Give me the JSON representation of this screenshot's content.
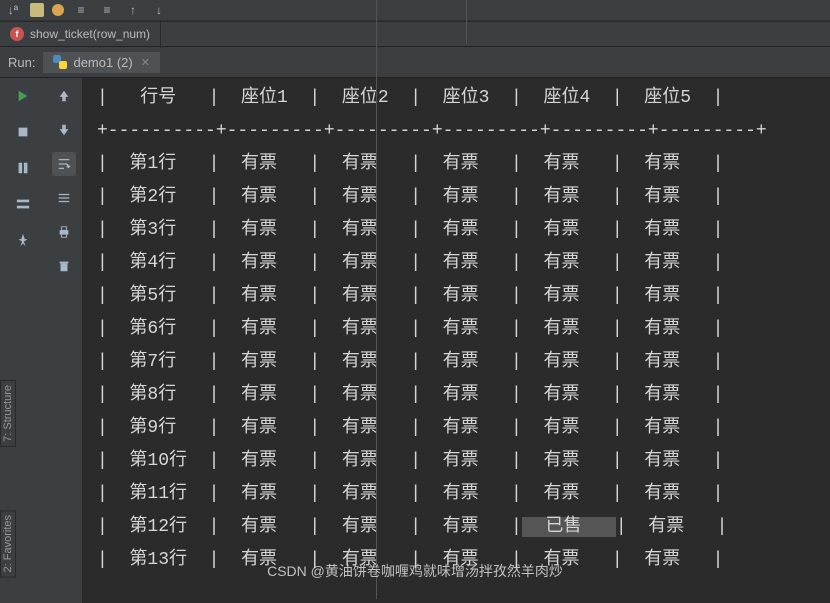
{
  "topTabs": {
    "functionTab": "show_ticket(row_num)"
  },
  "run": {
    "label": "Run:",
    "tabName": "demo1 (2)"
  },
  "table": {
    "headers": [
      "行号",
      "座位1",
      "座位2",
      "座位3",
      "座位4",
      "座位5"
    ],
    "rows": [
      {
        "label": "第1行",
        "cells": [
          "有票",
          "有票",
          "有票",
          "有票",
          "有票"
        ]
      },
      {
        "label": "第2行",
        "cells": [
          "有票",
          "有票",
          "有票",
          "有票",
          "有票"
        ]
      },
      {
        "label": "第3行",
        "cells": [
          "有票",
          "有票",
          "有票",
          "有票",
          "有票"
        ]
      },
      {
        "label": "第4行",
        "cells": [
          "有票",
          "有票",
          "有票",
          "有票",
          "有票"
        ]
      },
      {
        "label": "第5行",
        "cells": [
          "有票",
          "有票",
          "有票",
          "有票",
          "有票"
        ]
      },
      {
        "label": "第6行",
        "cells": [
          "有票",
          "有票",
          "有票",
          "有票",
          "有票"
        ]
      },
      {
        "label": "第7行",
        "cells": [
          "有票",
          "有票",
          "有票",
          "有票",
          "有票"
        ]
      },
      {
        "label": "第8行",
        "cells": [
          "有票",
          "有票",
          "有票",
          "有票",
          "有票"
        ]
      },
      {
        "label": "第9行",
        "cells": [
          "有票",
          "有票",
          "有票",
          "有票",
          "有票"
        ]
      },
      {
        "label": "第10行",
        "cells": [
          "有票",
          "有票",
          "有票",
          "有票",
          "有票"
        ]
      },
      {
        "label": "第11行",
        "cells": [
          "有票",
          "有票",
          "有票",
          "有票",
          "有票"
        ]
      },
      {
        "label": "第12行",
        "cells": [
          "有票",
          "有票",
          "有票",
          "已售",
          "有票"
        ],
        "sold_index": 3
      },
      {
        "label": "第13行",
        "cells": [
          "有票",
          "有票",
          "有票",
          "有票",
          "有票"
        ]
      }
    ]
  },
  "sideTabs": {
    "structure": "7: Structure",
    "favorites": "2: Favorites"
  },
  "watermark": "CSDN @黄油饼卷咖喱鸡就味增汤拌孜然羊肉炒"
}
